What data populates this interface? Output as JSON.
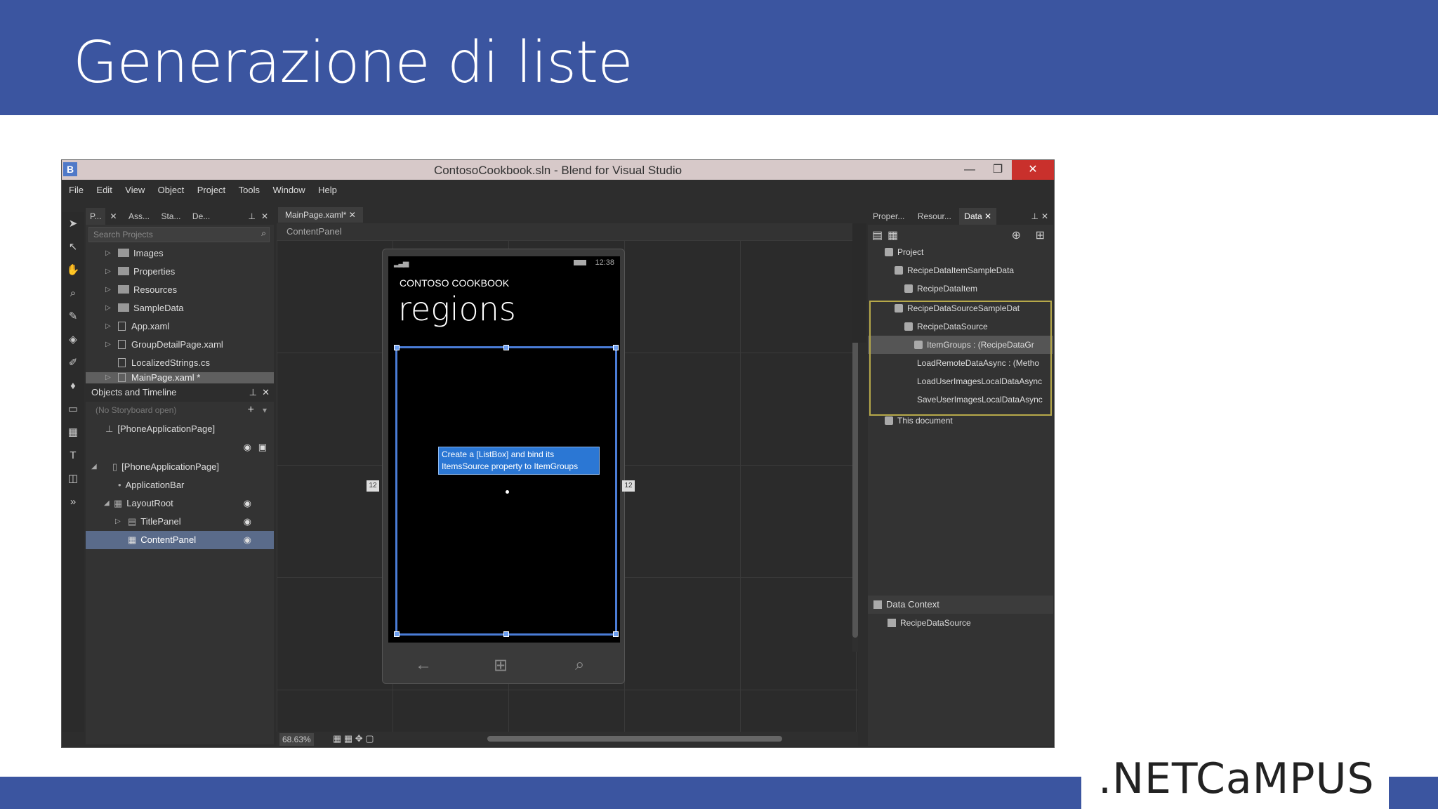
{
  "slide": {
    "title": "Generazione di liste",
    "logo": ".NETCaMPUS"
  },
  "window": {
    "title": "ContosoCookbook.sln - Blend for Visual Studio",
    "app_icon": "B",
    "minimize": "—",
    "restore": "❐",
    "close": "✕"
  },
  "menu": [
    "File",
    "Edit",
    "View",
    "Object",
    "Project",
    "Tools",
    "Window",
    "Help"
  ],
  "left_panel": {
    "tabs": [
      "P...",
      "Ass...",
      "Sta...",
      "De..."
    ],
    "search_placeholder": "Search Projects",
    "items": [
      {
        "label": "Images",
        "type": "folder"
      },
      {
        "label": "Properties",
        "type": "folder"
      },
      {
        "label": "Resources",
        "type": "folder"
      },
      {
        "label": "SampleData",
        "type": "folder"
      },
      {
        "label": "App.xaml",
        "type": "file"
      },
      {
        "label": "GroupDetailPage.xaml",
        "type": "file"
      },
      {
        "label": "LocalizedStrings.cs",
        "type": "file"
      },
      {
        "label": "MainPage.xaml *",
        "type": "file"
      }
    ],
    "objects_title": "Objects and Timeline",
    "storyboard": "(No Storyboard open)",
    "root_node": "[PhoneApplicationPage]",
    "objects": [
      {
        "label": "[PhoneApplicationPage]",
        "indent": 0
      },
      {
        "label": "ApplicationBar",
        "indent": 1
      },
      {
        "label": "LayoutRoot",
        "indent": 1
      },
      {
        "label": "TitlePanel",
        "indent": 2
      },
      {
        "label": "ContentPanel",
        "indent": 2
      }
    ]
  },
  "document": {
    "tab": "MainPage.xaml*",
    "breadcrumb": "ContentPanel",
    "zoom": "68.63%",
    "margin_left": "12",
    "margin_right": "12"
  },
  "phone": {
    "time": "12:38",
    "subtitle": "CONTOSO COOKBOOK",
    "title": "regions",
    "hint": "Create a [ListBox] and bind its ItemsSource property to ItemGroups",
    "nav_back": "←",
    "nav_start": "⊞",
    "nav_search": "⌕"
  },
  "right_panel": {
    "tabs": [
      "Proper...",
      "Resour...",
      "Data"
    ],
    "project_label": "Project",
    "items": [
      {
        "label": "RecipeDataItemSampleData",
        "indent": 1
      },
      {
        "label": "RecipeDataItem",
        "indent": 2
      },
      {
        "label": "RecipeDataSourceSampleDat",
        "indent": 1
      },
      {
        "label": "RecipeDataSource",
        "indent": 2
      },
      {
        "label": "ItemGroups : (RecipeDataGr",
        "indent": 3
      },
      {
        "label": "LoadRemoteDataAsync : (Metho",
        "indent": 4
      },
      {
        "label": "LoadUserImagesLocalDataAsync",
        "indent": 4
      },
      {
        "label": "SaveUserImagesLocalDataAsync",
        "indent": 4
      }
    ],
    "this_document": "This document",
    "data_context_title": "Data Context",
    "data_context_item": "RecipeDataSource"
  }
}
